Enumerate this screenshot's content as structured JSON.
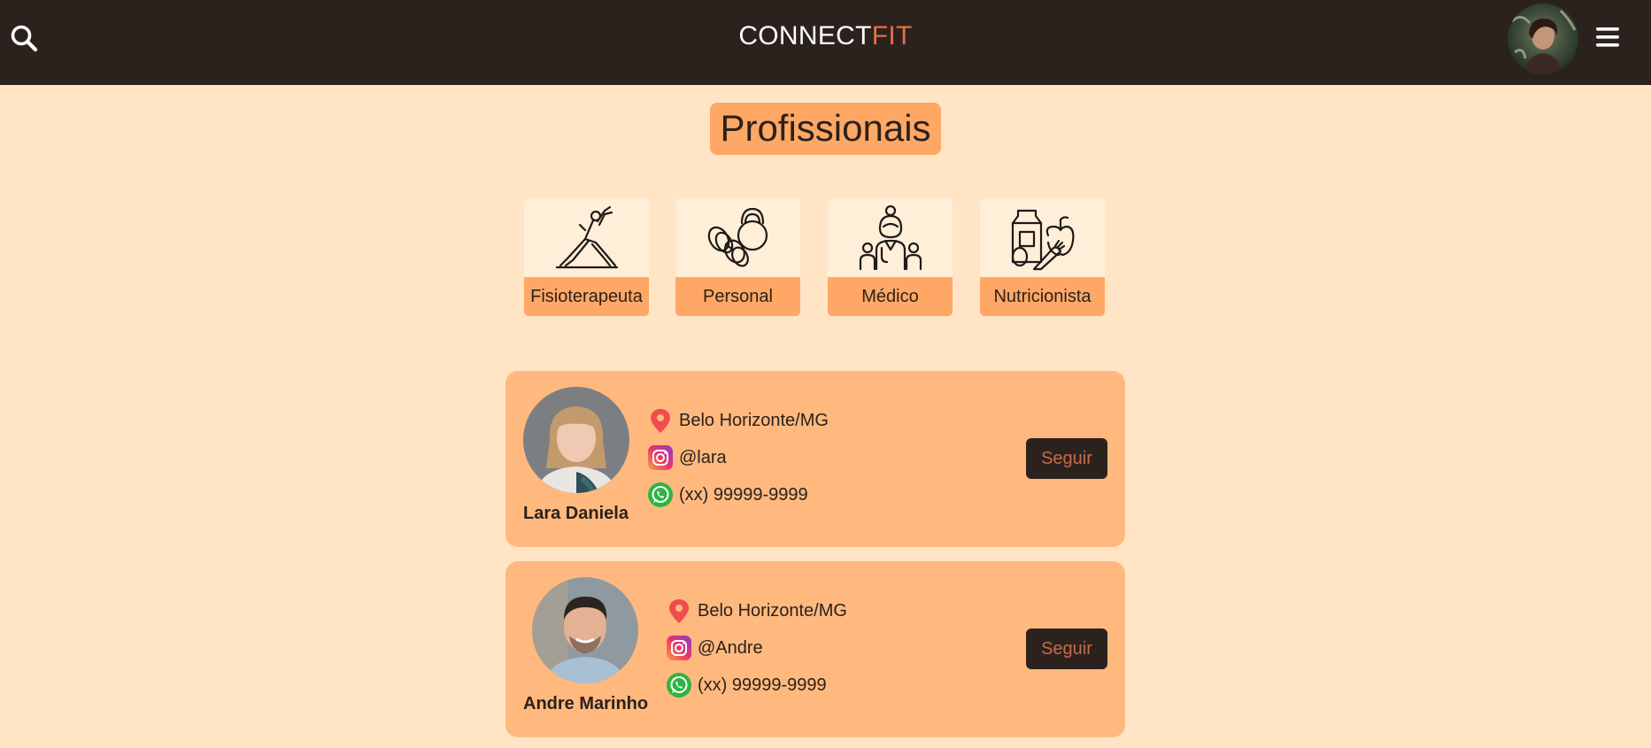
{
  "header": {
    "brand_part1": "CONNECT",
    "brand_part2": "FIT",
    "colors": {
      "bar": "#2c221d",
      "brand_accent": "#e56f4a"
    },
    "icons": [
      "search-icon",
      "avatar",
      "hamburger-menu-icon"
    ]
  },
  "page": {
    "title": "Profissionais"
  },
  "categories": [
    {
      "label": "Fisioterapeuta",
      "icon": "stretching-person-icon"
    },
    {
      "label": "Personal",
      "icon": "dumbbells-kettlebell-icon"
    },
    {
      "label": "Médico",
      "icon": "doctor-icon"
    },
    {
      "label": "Nutricionista",
      "icon": "food-milk-apple-icon"
    }
  ],
  "professionals": [
    {
      "name": "Lara Daniela",
      "location": "Belo Horizonte/MG",
      "instagram": "@lara",
      "whatsapp": "(xx) 99999-9999",
      "button": "Seguir"
    },
    {
      "name": "Andre Marinho",
      "location": "Belo Horizonte/MG",
      "instagram": "@Andre",
      "whatsapp": "(xx) 99999-9999",
      "button": "Seguir"
    }
  ],
  "colors": {
    "background": "#ffe5c6",
    "card": "#ffb97f",
    "accent": "#ffa865",
    "button": "#2c221d",
    "button_text": "#c66c4b"
  }
}
